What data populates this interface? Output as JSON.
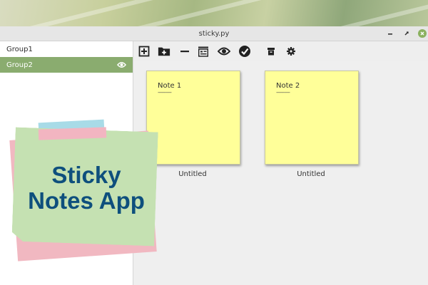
{
  "window": {
    "title": "sticky.py"
  },
  "sidebar": {
    "groups": [
      {
        "label": "Group1",
        "selected": false
      },
      {
        "label": "Group2",
        "selected": true
      }
    ]
  },
  "toolbar": {
    "buttons": [
      {
        "icon": "new-note-icon"
      },
      {
        "icon": "new-group-icon"
      },
      {
        "icon": "remove-icon"
      },
      {
        "icon": "properties-icon"
      },
      {
        "icon": "show-icon"
      },
      {
        "icon": "check-icon"
      },
      {
        "icon": "archive-icon"
      },
      {
        "icon": "settings-icon"
      }
    ]
  },
  "notes": [
    {
      "title": "Note 1",
      "rule": "----------",
      "caption": "Untitled"
    },
    {
      "title": "Note 2",
      "rule": "----------",
      "caption": "Untitled"
    }
  ],
  "overlay": {
    "line1": "Sticky",
    "line2": "Notes App"
  },
  "colors": {
    "selected_row": "#8aac6f",
    "note_yellow": "#ffff99",
    "overlay_text": "#0e4f7d",
    "sticky_green": "#c5e1b2",
    "sticky_pink": "#f1b8c1",
    "tape_blue": "#a8dbe7"
  }
}
